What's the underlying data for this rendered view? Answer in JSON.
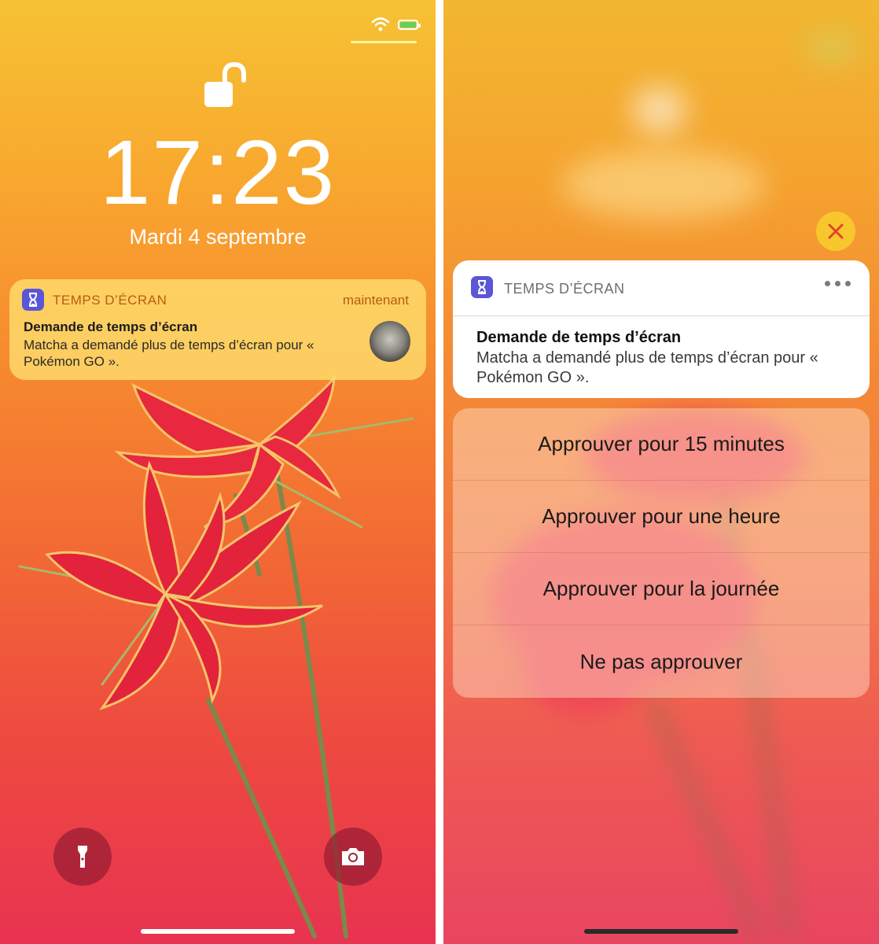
{
  "lock_screen": {
    "time": "17:23",
    "date": "Mardi 4 septembre",
    "notification": {
      "app_name": "TEMPS D’ÉCRAN",
      "timestamp": "maintenant",
      "title": "Demande de temps d’écran",
      "body": "Matcha a demandé plus de temps d’écran pour « Pokémon GO »."
    },
    "icons": {
      "lock": "lock-open-icon",
      "wifi": "wifi-icon",
      "battery": "battery-charging-icon",
      "flashlight": "flashlight-icon",
      "camera": "camera-icon"
    }
  },
  "expanded_notification": {
    "app_name": "TEMPS D’ÉCRAN",
    "title": "Demande de temps d’écran",
    "body": "Matcha a demandé plus de temps d’écran pour « Pokémon GO ».",
    "actions": [
      "Approuver pour 15 minutes",
      "Approuver pour une heure",
      "Approuver pour la journée",
      "Ne pas approuver"
    ],
    "icons": {
      "close": "close-icon",
      "more": "more-options-icon"
    }
  },
  "colors": {
    "app_icon": "#5b56d6",
    "close_button": "#f7c72d",
    "close_x": "#e0452d",
    "notification_accent": "#b85d10"
  }
}
